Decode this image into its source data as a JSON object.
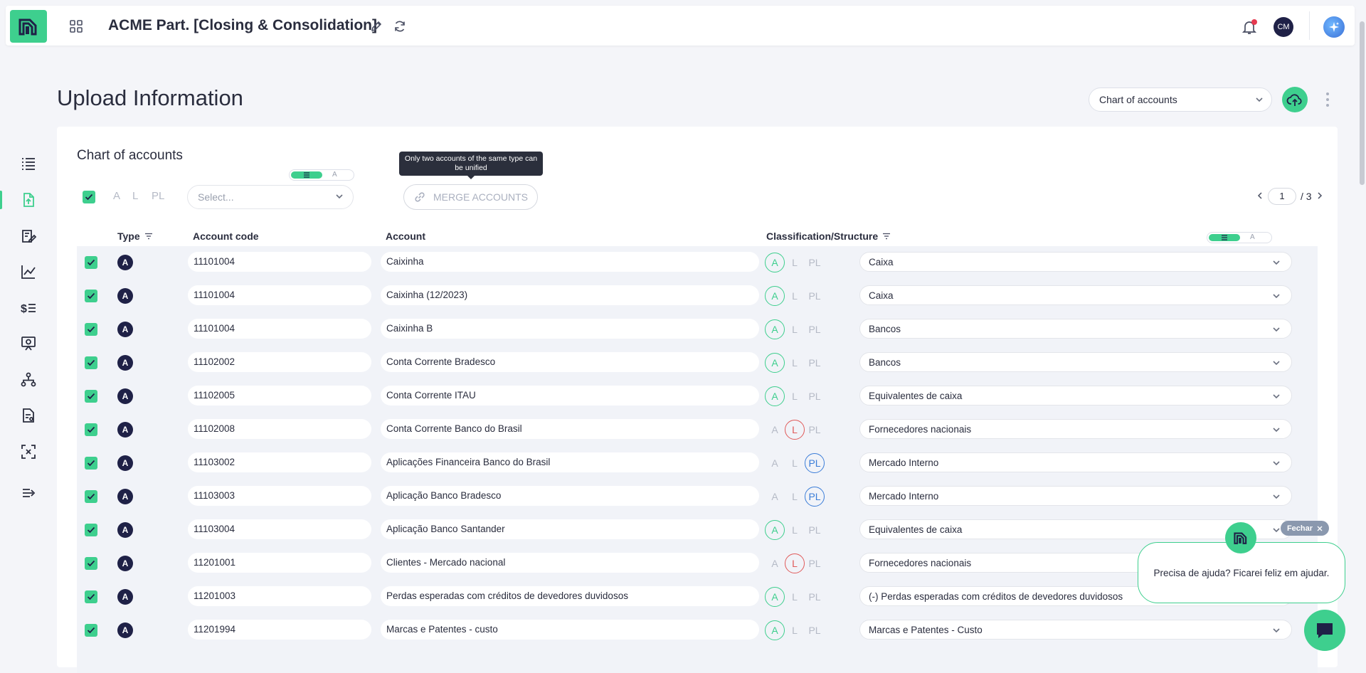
{
  "app": {
    "title": "ACME Part. [Closing & Consolidation]",
    "avatar_initials": "CM",
    "brand_color": "#3ecf8e"
  },
  "sidebar": {
    "items": [
      {
        "name": "list-icon"
      },
      {
        "name": "file-upload-icon",
        "active": true
      },
      {
        "name": "clipboard-edit-icon"
      },
      {
        "name": "line-chart-icon"
      },
      {
        "name": "dollar-list-icon"
      },
      {
        "name": "presentation-icon"
      },
      {
        "name": "hierarchy-icon"
      },
      {
        "name": "report-file-icon"
      },
      {
        "name": "expand-icon"
      },
      {
        "name": "collapse-menu-icon"
      }
    ]
  },
  "page": {
    "title": "Upload Information",
    "source_select": "Chart of accounts"
  },
  "card": {
    "title": "Chart of accounts",
    "filters": {
      "a": "A",
      "l": "L",
      "pl": "PL"
    },
    "view_toggle_off": "A",
    "select_placeholder": "Select...",
    "merge_label": "MERGE ACCOUNTS",
    "merge_tooltip": "Only two accounts of the same type can be unified",
    "pager": {
      "current": "1",
      "total": "/ 3"
    }
  },
  "table": {
    "headers": {
      "type": "Type",
      "code": "Account code",
      "account": "Account",
      "classification": "Classification/Structure"
    },
    "rows": [
      {
        "type": "A",
        "code": "11101004",
        "account": "Caixinha",
        "class": "A",
        "structure": "Caixa"
      },
      {
        "type": "A",
        "code": "11101004",
        "account": "Caixinha (12/2023)",
        "class": "A",
        "structure": "Caixa"
      },
      {
        "type": "A",
        "code": "11101004",
        "account": "Caixinha B",
        "class": "A",
        "structure": "Bancos"
      },
      {
        "type": "A",
        "code": "11102002",
        "account": "Conta Corrente Bradesco",
        "class": "A",
        "structure": "Bancos"
      },
      {
        "type": "A",
        "code": "11102005",
        "account": "Conta Corrente ITAU",
        "class": "A",
        "structure": "Equivalentes de caixa"
      },
      {
        "type": "A",
        "code": "11102008",
        "account": "Conta Corrente Banco do Brasil",
        "class": "L",
        "structure": "Fornecedores nacionais"
      },
      {
        "type": "A",
        "code": "11103002",
        "account": "Aplicações Financeira Banco do Brasil",
        "class": "PL",
        "structure": "Mercado Interno"
      },
      {
        "type": "A",
        "code": "11103003",
        "account": "Aplicação Banco Bradesco",
        "class": "PL",
        "structure": "Mercado Interno"
      },
      {
        "type": "A",
        "code": "11103004",
        "account": "Aplicação Banco Santander",
        "class": "A",
        "structure": "Equivalentes de caixa"
      },
      {
        "type": "A",
        "code": "11201001",
        "account": "Clientes - Mercado nacional",
        "class": "L",
        "structure": "Fornecedores nacionais"
      },
      {
        "type": "A",
        "code": "11201003",
        "account": "Perdas esperadas com créditos de devedores duvidosos",
        "class": "A",
        "structure": "(-) Perdas esperadas com créditos de devedores duvidosos"
      },
      {
        "type": "A",
        "code": "11201994",
        "account": "Marcas e Patentes - custo",
        "class": "A",
        "structure": "Marcas e Patentes - Custo"
      }
    ]
  },
  "help": {
    "close_label": "Fechar",
    "message": "Precisa de ajuda? Ficarei feliz em ajudar."
  }
}
